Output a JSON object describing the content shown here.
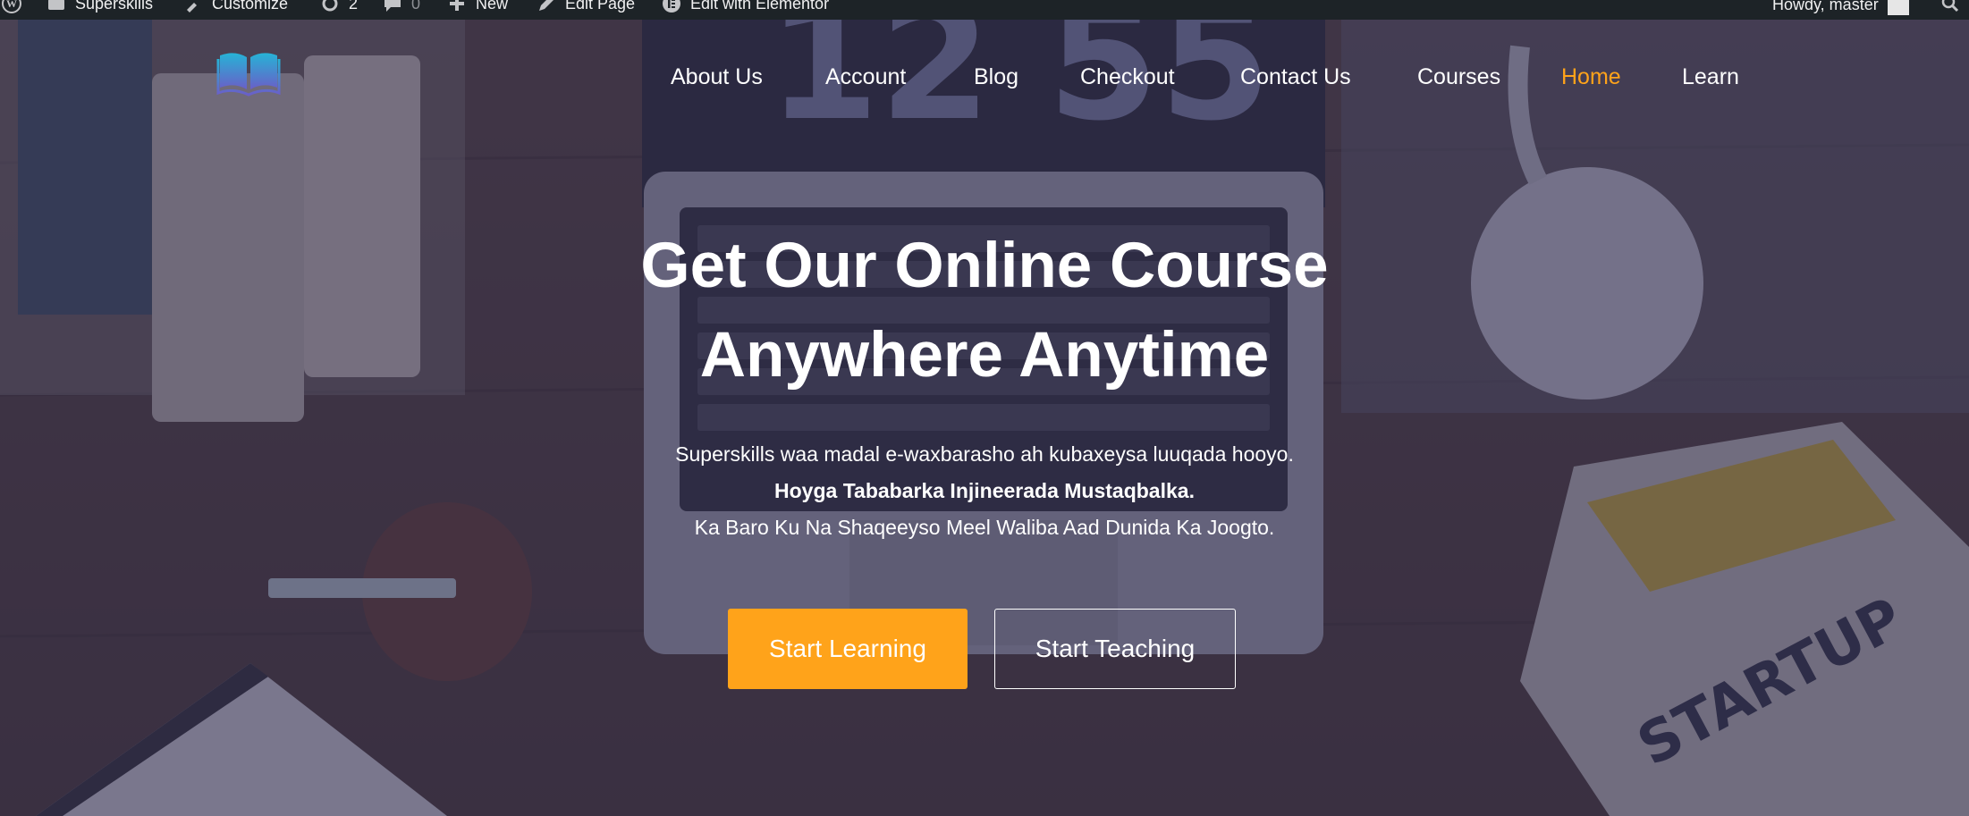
{
  "admin_bar": {
    "site_name": "Superskills",
    "customize": "Customize",
    "updates_count": "2",
    "comments_count": "0",
    "new": "New",
    "edit_page": "Edit Page",
    "edit_with_elementor": "Edit with Elementor",
    "howdy": "Howdy, master"
  },
  "nav": {
    "logo_icon": "open-book-icon",
    "items": [
      {
        "label": "About Us",
        "active": false
      },
      {
        "label": "Account",
        "active": false
      },
      {
        "label": "Blog",
        "active": false
      },
      {
        "label": "Checkout",
        "active": false
      },
      {
        "label": "Contact Us",
        "active": false
      },
      {
        "label": "Courses",
        "active": false
      },
      {
        "label": "Home",
        "active": true
      },
      {
        "label": "Learn",
        "active": false
      }
    ],
    "active_color": "#ffa31a"
  },
  "hero": {
    "headline_line1": "Get Our Online Course",
    "headline_line2": "Anywhere Anytime",
    "subtitle_line1": "Superskills waa madal e-waxbarasho ah kubaxeysa luuqada hooyo.",
    "subtitle_line2": "Hoyga Tababarka Injineerada Mustaqbalka.",
    "subtitle_line3": "Ka Baro Ku Na Shaqeeyso Meel Waliba Aad Dunida Ka Joogto.",
    "primary_button": "Start Learning",
    "secondary_button": "Start Teaching",
    "primary_color": "#ffa31a"
  }
}
